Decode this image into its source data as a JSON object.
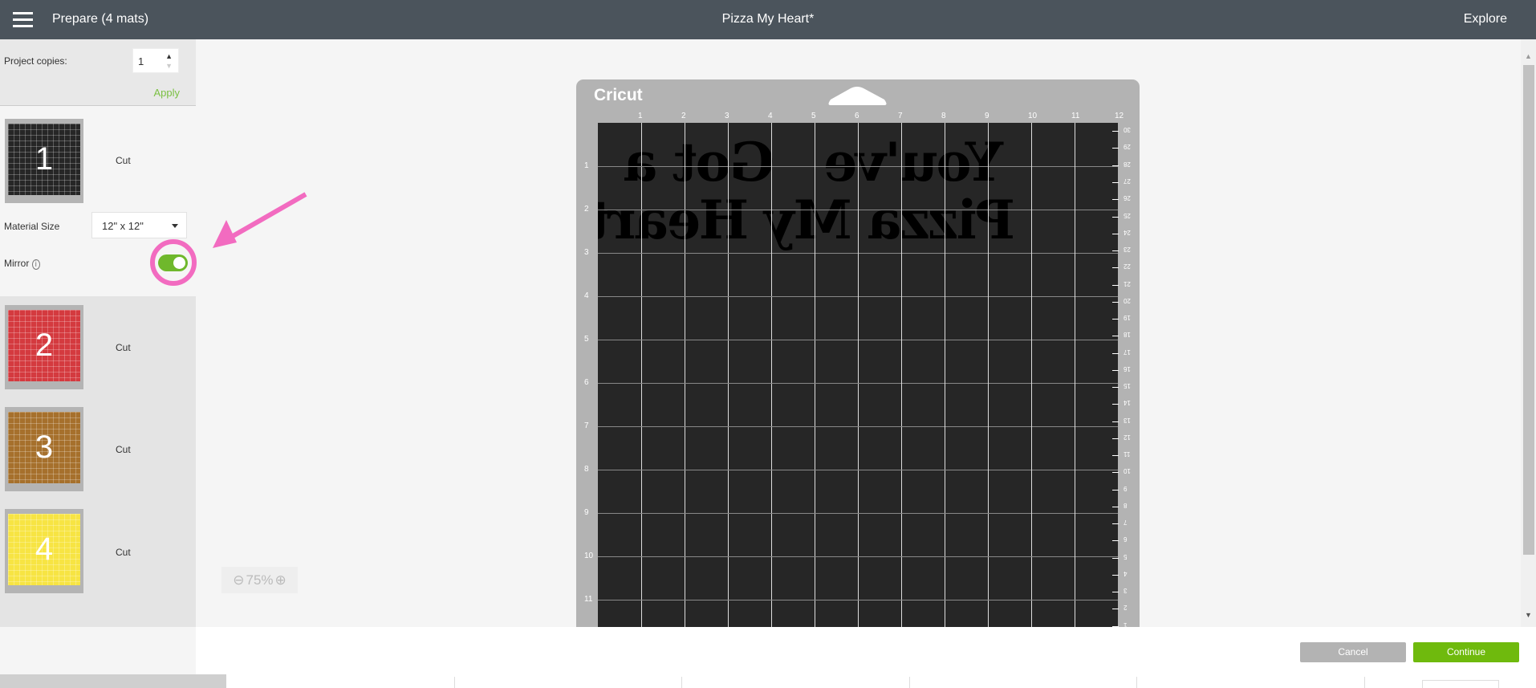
{
  "header": {
    "menu_icon": "hamburger-icon",
    "left_title": "Prepare (4 mats)",
    "title": "Pizza My Heart*",
    "explore": "Explore"
  },
  "sidebar": {
    "project_copies_label": "Project copies:",
    "project_copies_value": "1",
    "apply": "Apply",
    "material_size_label": "Material Size",
    "material_size_value": "12\" x 12\"",
    "mirror_label": "Mirror",
    "mirror_on": true,
    "mats": [
      {
        "number": "1",
        "action": "Cut",
        "color": "#262626"
      },
      {
        "number": "2",
        "action": "Cut",
        "color": "#d43a3f"
      },
      {
        "number": "3",
        "action": "Cut",
        "color": "#a6702c"
      },
      {
        "number": "4",
        "action": "Cut",
        "color": "#f7e443"
      }
    ]
  },
  "mat": {
    "brand": "Cricut",
    "text_line1": "You've   Got a",
    "text_line2": "Pizza My Heart!",
    "mirrored": true,
    "top_ruler": [
      "1",
      "2",
      "3",
      "4",
      "5",
      "6",
      "7",
      "8",
      "9",
      "10",
      "11",
      "12"
    ],
    "left_ruler": [
      "1",
      "2",
      "3",
      "4",
      "5",
      "6",
      "7",
      "8",
      "9",
      "10",
      "11"
    ],
    "right_ruler": [
      "30",
      "29",
      "28",
      "27",
      "26",
      "25",
      "24",
      "23",
      "22",
      "21",
      "20",
      "19",
      "18",
      "17",
      "16",
      "15",
      "14",
      "13",
      "12",
      "11",
      "10",
      "9",
      "8",
      "7",
      "6",
      "5",
      "4",
      "3",
      "2",
      "1"
    ]
  },
  "zoom": {
    "level": "75%",
    "minus": "⊖",
    "plus": "⊕"
  },
  "footer": {
    "cancel": "Cancel",
    "continue": "Continue",
    "cancel_color": "#b3b3b3",
    "continue_color": "#6fba0d"
  },
  "annotation_color": "#f26bc0"
}
